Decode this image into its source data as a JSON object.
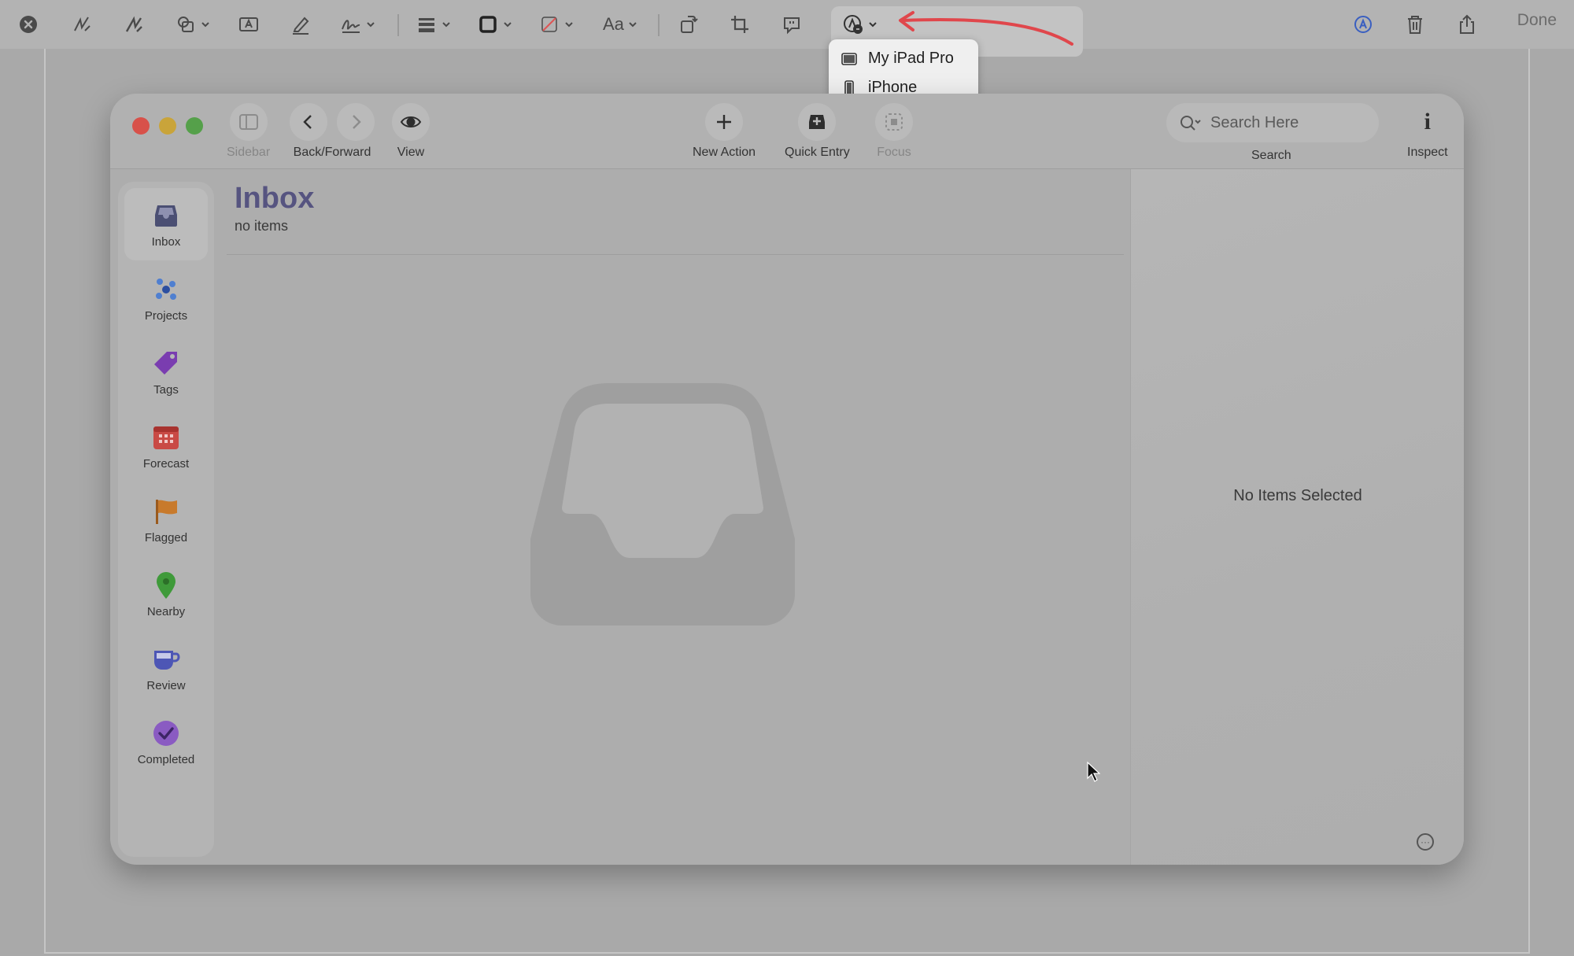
{
  "markup_toolbar": {
    "done_label": "Done",
    "tools": [
      "close-icon",
      "sketch-icon",
      "draw-icon",
      "shapes-icon",
      "text-box-icon",
      "highlight-icon",
      "sign-icon",
      "line-style-icon",
      "border-color-icon",
      "fill-color-icon",
      "text-style-icon",
      "rotate-icon",
      "crop-icon",
      "annotate-icon",
      "share-device-icon",
      "markup-autofill-icon",
      "trash-icon",
      "share-icon"
    ],
    "text_style_label": "Aa",
    "annotation_arrow_color": "#e0474c"
  },
  "device_menu": {
    "items": [
      {
        "label": "My iPad Pro",
        "icon": "ipad-icon"
      },
      {
        "label": "iPhone",
        "icon": "iphone-icon"
      }
    ]
  },
  "window": {
    "toolbar": {
      "sidebar_label": "Sidebar",
      "back_forward_label": "Back/Forward",
      "view_label": "View",
      "new_action_label": "New Action",
      "quick_entry_label": "Quick Entry",
      "focus_label": "Focus",
      "search_placeholder": "Search Here",
      "search_label": "Search",
      "inspect_label": "Inspect"
    },
    "sidebar": {
      "items": [
        {
          "label": "Inbox",
          "icon": "inbox-icon",
          "color": "#4b4f73"
        },
        {
          "label": "Projects",
          "icon": "projects-icon",
          "color": "#3a64b8"
        },
        {
          "label": "Tags",
          "icon": "tag-icon",
          "color": "#7a3db0"
        },
        {
          "label": "Forecast",
          "icon": "calendar-icon",
          "color": "#c94a45"
        },
        {
          "label": "Flagged",
          "icon": "flag-icon",
          "color": "#c87a2c"
        },
        {
          "label": "Nearby",
          "icon": "location-pin-icon",
          "color": "#3f9a3a"
        },
        {
          "label": "Review",
          "icon": "cup-icon",
          "color": "#4d56b5"
        },
        {
          "label": "Completed",
          "icon": "checkmark-circle-icon",
          "color": "#8a5bc2"
        }
      ]
    },
    "main": {
      "title": "Inbox",
      "subtitle": "no items"
    },
    "inspector": {
      "empty_text": "No Items Selected",
      "more_glyph": "···"
    }
  }
}
